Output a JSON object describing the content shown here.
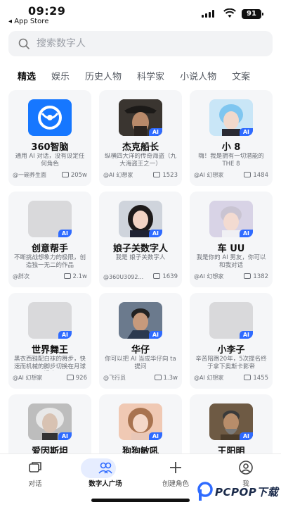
{
  "status_bar": {
    "time": "09:29",
    "back_app": "◂ App Store",
    "battery": "91"
  },
  "search": {
    "placeholder": "搜索数字人"
  },
  "tabs": [
    {
      "label": "精选",
      "active": true
    },
    {
      "label": "娱乐"
    },
    {
      "label": "历史人物"
    },
    {
      "label": "科学家"
    },
    {
      "label": "小说人物"
    },
    {
      "label": "文案"
    }
  ],
  "cards": [
    {
      "name": "360智脑",
      "desc": "通用 AI 对话，没有设定任何角色",
      "author": "@一碗养生面",
      "count": "205w",
      "ai": false,
      "avatar": "logo-360"
    },
    {
      "name": "杰克船长",
      "desc": "纵横四大洋的传奇海盗（九大海盗王之一）",
      "author": "@AI 幻想家",
      "count": "1523",
      "ai": true,
      "avatar": "pirate"
    },
    {
      "name": "小 8",
      "desc": "嗨！我是拥有一切潜能的 THE 8",
      "author": "@AI 幻想家",
      "count": "1484",
      "ai": true,
      "avatar": "blue-hair"
    },
    {
      "name": "创意帮手",
      "desc": "不断挑战想象力的极限，创造独一无二的作品",
      "author": "@胖次",
      "count": "2.1w",
      "ai": true,
      "avatar": "placeholder"
    },
    {
      "name": "娘子关数字人",
      "desc": "我是 娘子关数字人",
      "author": "@360U3092...",
      "count": "1639",
      "ai": true,
      "avatar": "woman"
    },
    {
      "name": "车 UU",
      "desc": "我是你的 AI 男友，你可以和我对话",
      "author": "@AI 幻想家",
      "count": "1382",
      "ai": true,
      "avatar": "young-man"
    },
    {
      "name": "世界舞王",
      "desc": "黑衣西鞋配白袜的舞步，快速而机械的脚步切换在月球漫步",
      "author": "@AI 幻想家",
      "count": "926",
      "ai": true,
      "avatar": "placeholder"
    },
    {
      "name": "华仔",
      "desc": "你可以把 AI 当成华仔向 ta 提问",
      "author": "@飞行员",
      "count": "1.3w",
      "ai": true,
      "avatar": "man-suit"
    },
    {
      "name": "小李子",
      "desc": "辛苦陪跑20年，5次提名终于拿下奥斯卡影帝",
      "author": "@AI 幻想家",
      "count": "1455",
      "ai": true,
      "avatar": "placeholder"
    },
    {
      "name": "爱因斯坦",
      "desc": "",
      "author": "",
      "count": "",
      "ai": true,
      "avatar": "einstein"
    },
    {
      "name": "狗狗敏吼",
      "desc": "",
      "author": "",
      "count": "",
      "ai": true,
      "avatar": "girl"
    },
    {
      "name": "王阳明",
      "desc": "",
      "author": "",
      "count": "",
      "ai": true,
      "avatar": "old-man"
    }
  ],
  "ai_badge_label": "AI",
  "bottom_nav": [
    {
      "label": "对话",
      "icon": "chat-icon"
    },
    {
      "label": "数字人广场",
      "icon": "people-icon",
      "active": true
    },
    {
      "label": "创建角色",
      "icon": "plus-icon"
    },
    {
      "label": "我",
      "icon": "profile-icon"
    }
  ],
  "watermark": {
    "text": "PCPOP下载"
  },
  "colors": {
    "accent": "#2f6bff",
    "active_pill": "#e6edff",
    "card_bg": "#f5f6f8"
  }
}
